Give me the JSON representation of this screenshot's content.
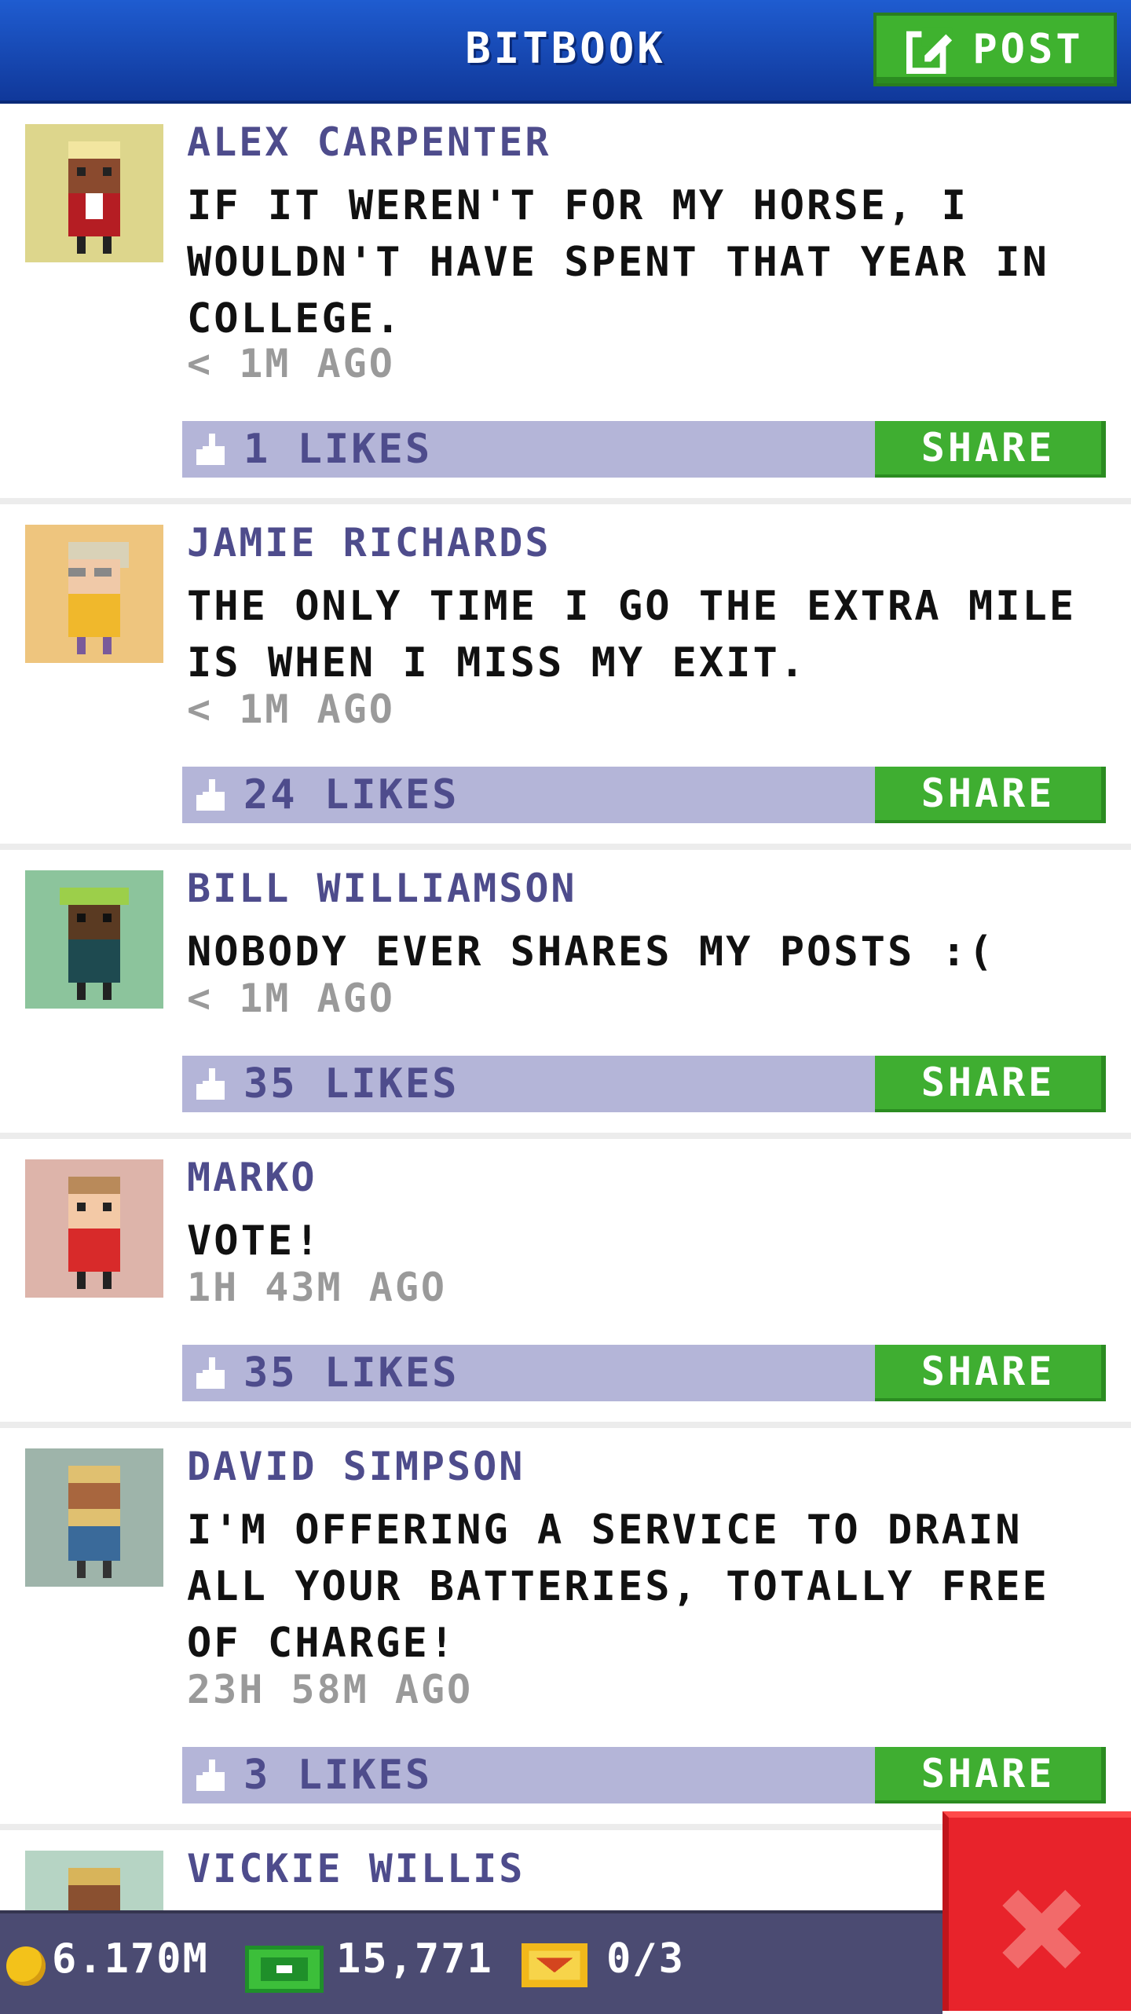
{
  "header": {
    "title": "BITBOOK",
    "post_label": "POST"
  },
  "posts": [
    {
      "author": "ALEX CARPENTER",
      "message": "IF IT WEREN'T FOR MY HORSE, I WOULDN'T HAVE SPENT THAT YEAR IN COLLEGE.",
      "time": "< 1M AGO",
      "likes": "1 LIKES",
      "share": "SHARE",
      "avatar_bg": "#ddd68c"
    },
    {
      "author": "JAMIE RICHARDS",
      "message": "THE ONLY TIME I GO THE EXTRA MILE IS WHEN I MISS MY EXIT.",
      "time": "< 1M AGO",
      "likes": "24 LIKES",
      "share": "SHARE",
      "avatar_bg": "#eec57e"
    },
    {
      "author": "BILL WILLIAMSON",
      "message": "NOBODY EVER SHARES MY POSTS :(",
      "time": "< 1M AGO",
      "likes": "35 LIKES",
      "share": "SHARE",
      "avatar_bg": "#8cc49c"
    },
    {
      "author": "MARKO",
      "message": "VOTE!",
      "time": "1H 43M AGO",
      "likes": "35 LIKES",
      "share": "SHARE",
      "avatar_bg": "#ddb4aa"
    },
    {
      "author": "DAVID SIMPSON",
      "message": "I'M OFFERING A SERVICE TO DRAIN ALL YOUR BATTERIES, TOTALLY FREE OF CHARGE!",
      "time": "23H 58M AGO",
      "likes": "3 LIKES",
      "share": "SHARE",
      "avatar_bg": "#9eb4aa"
    },
    {
      "author": "VICKIE WILLIS",
      "avatar_bg": "#b6d4c4"
    }
  ],
  "status": {
    "coins": "6.170M",
    "bux": "15,771",
    "tickets": "0/3"
  },
  "colors": {
    "header_blue": "#1f5cd0",
    "share_green": "#3fae31",
    "like_bar": "#b4b5d8",
    "author_purple": "#4e4c8c",
    "close_red": "#e8232b"
  }
}
